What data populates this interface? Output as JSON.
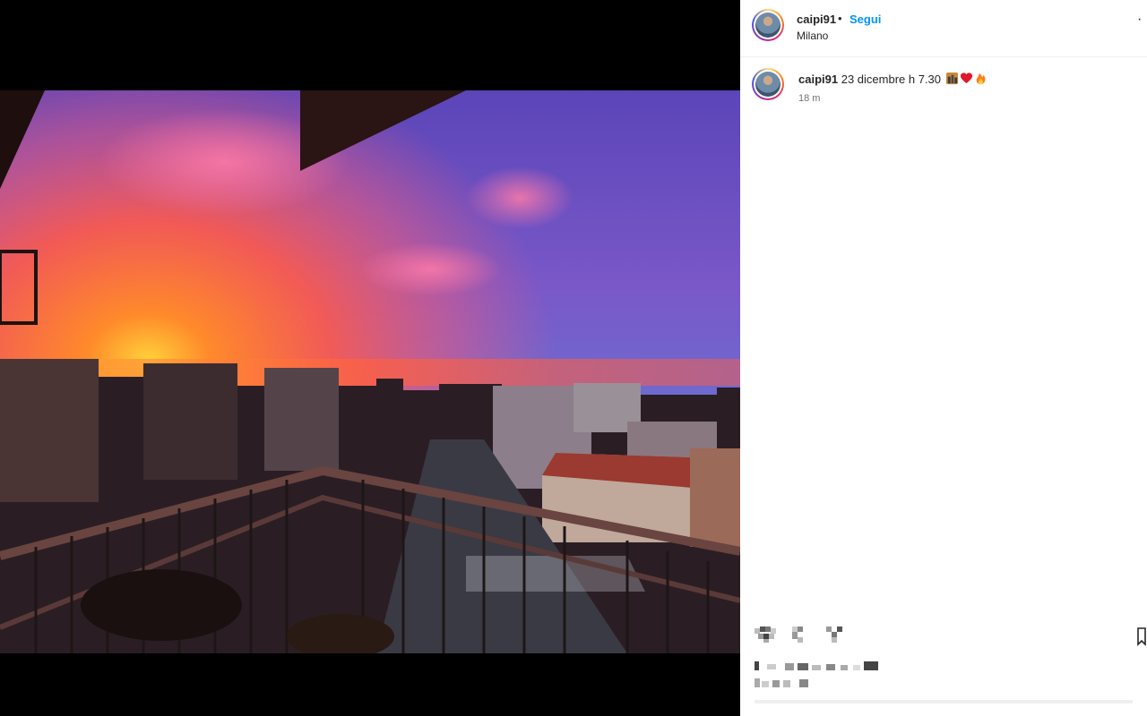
{
  "post": {
    "username": "caipi91",
    "separator": "•",
    "follow_label": "Segui",
    "location": "Milano",
    "more_label": "·",
    "caption_text": "23 dicembre h 7.30",
    "time_ago": "18 m"
  },
  "icons": {
    "more": "more-options-icon",
    "emoji1": "sunrise-over-buildings-emoji",
    "emoji2": "red-heart-emoji",
    "emoji3": "fire-emoji",
    "like": "heart-icon",
    "comment": "comment-icon",
    "share": "share-icon",
    "save": "bookmark-icon"
  },
  "colors": {
    "follow": "#0095f6",
    "text": "#262626",
    "muted": "#737373"
  }
}
